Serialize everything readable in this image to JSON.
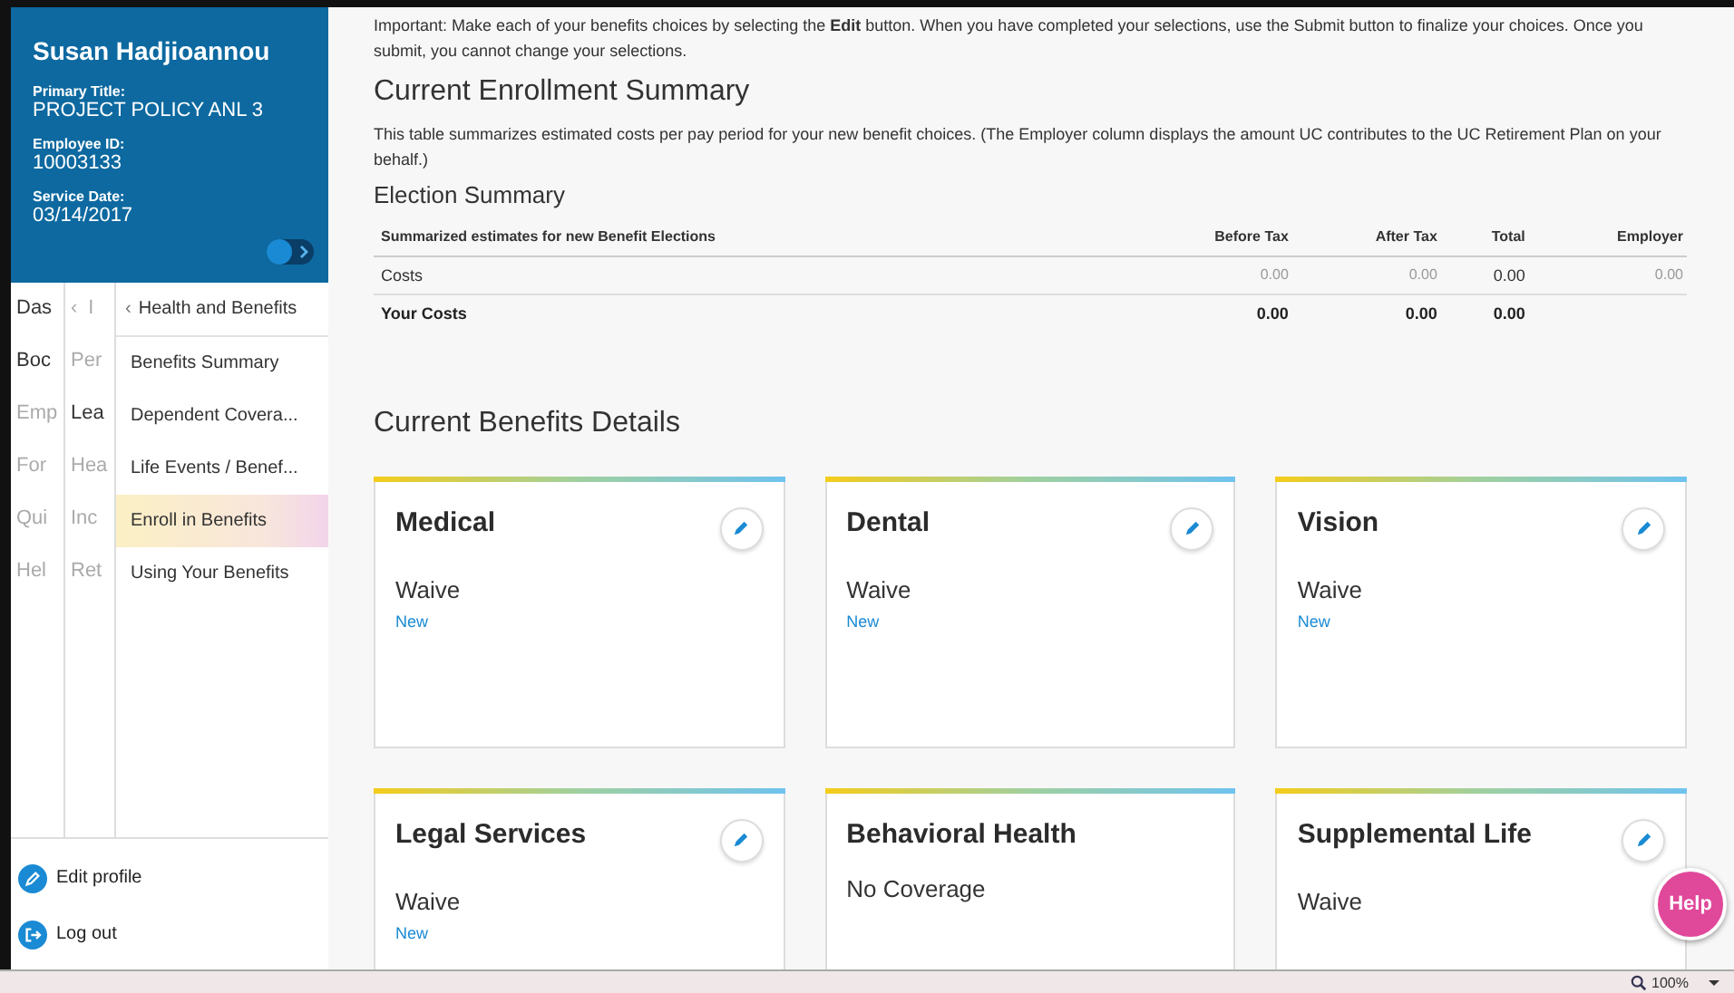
{
  "profile": {
    "name": "Susan Hadjioannou",
    "fields": [
      {
        "label": "Primary Title:",
        "value": "PROJECT POLICY ANL 3"
      },
      {
        "label": "Employee ID:",
        "value": "10003133"
      },
      {
        "label": "Service Date:",
        "value": "03/14/2017"
      }
    ]
  },
  "nav": {
    "level1": [
      {
        "label": "Das",
        "dim": false
      },
      {
        "label": "Boc",
        "dim": false
      },
      {
        "label": "Emp",
        "dim": true
      },
      {
        "label": "For",
        "dim": true
      },
      {
        "label": "Qui",
        "dim": true
      },
      {
        "label": "Hel",
        "dim": true
      }
    ],
    "level2": {
      "back": "‹",
      "title": "I",
      "items": [
        {
          "label": "Per",
          "dim": true
        },
        {
          "label": "Lea",
          "dim": false
        },
        {
          "label": "Hea",
          "dim": true
        },
        {
          "label": "Inc",
          "dim": true
        },
        {
          "label": "Ret",
          "dim": true
        }
      ]
    },
    "level3": {
      "back": "‹",
      "title": "Health and Benefits",
      "items": [
        {
          "label": "Benefits Summary",
          "selected": false
        },
        {
          "label": "Dependent Covera...",
          "selected": false
        },
        {
          "label": "Life Events / Benef...",
          "selected": false
        },
        {
          "label": "Enroll in Benefits",
          "selected": true
        },
        {
          "label": "Using Your Benefits",
          "selected": false
        }
      ]
    }
  },
  "footer_links": [
    {
      "kind": "edit",
      "label": "Edit profile"
    },
    {
      "kind": "logout",
      "label": "Log out"
    }
  ],
  "notice": "Important: Make each of your benefits choices by selecting the **Edit** button. When you have completed your selections, use the Submit button to finalize your choices. Once you submit, you cannot change your selections.",
  "summary": {
    "title": "Current Enrollment Summary",
    "description": "This table summarizes estimated costs per pay period for your new benefit choices. (The Employer column displays the amount UC contributes to the UC Retirement Plan on your behalf.)",
    "subtitle": "Election Summary",
    "columns": [
      "Summarized estimates for new Benefit Elections",
      "Before Tax",
      "After Tax",
      "Total",
      "Employer"
    ],
    "rows": [
      {
        "kind": "normal",
        "cells": [
          "Costs",
          "0.00",
          "0.00",
          "0.00",
          "0.00"
        ]
      },
      {
        "kind": "total",
        "cells": [
          "Your Costs",
          "0.00",
          "0.00",
          "0.00",
          ""
        ]
      }
    ]
  },
  "details": {
    "title": "Current Benefits Details",
    "cards": [
      {
        "title": "Medical",
        "status": "Waive",
        "note": "New",
        "editable": true
      },
      {
        "title": "Dental",
        "status": "Waive",
        "note": "New",
        "editable": true
      },
      {
        "title": "Vision",
        "status": "Waive",
        "note": "New",
        "editable": true
      },
      {
        "title": "Legal Services",
        "status": "Waive",
        "note": "New",
        "editable": true
      },
      {
        "title": "Behavioral Health",
        "status": "No Coverage",
        "editable": false
      },
      {
        "title": "Supplemental Life",
        "status": "Waive",
        "editable": true
      }
    ]
  },
  "sidebar_toggle": {
    "on": true
  },
  "help_button": "Help",
  "status_bar": {
    "zoom": "100%"
  }
}
